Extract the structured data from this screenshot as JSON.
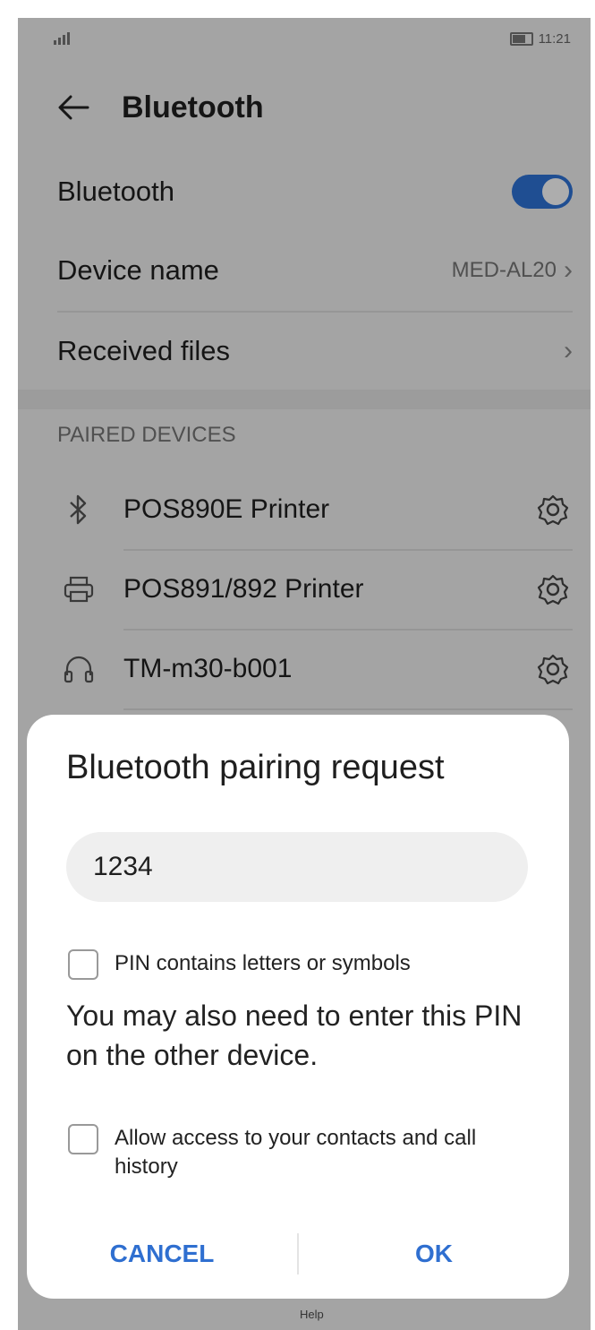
{
  "status_bar": {
    "time": "11:21"
  },
  "header": {
    "title": "Bluetooth",
    "back_icon": "arrow-left-icon"
  },
  "settings": {
    "bluetooth_label": "Bluetooth",
    "bluetooth_enabled": true,
    "device_name_label": "Device name",
    "device_name_value": "MED-AL20",
    "received_files_label": "Received files"
  },
  "paired": {
    "section_label": "PAIRED DEVICES",
    "devices": [
      {
        "name": "POS890E Printer",
        "icon": "bluetooth-icon"
      },
      {
        "name": "POS891/892 Printer",
        "icon": "printer-icon"
      },
      {
        "name": "TM-m30-b001",
        "icon": "headphones-icon"
      }
    ]
  },
  "dialog": {
    "title": "Bluetooth pairing request",
    "pin_value": "1234",
    "pin_letters_label": "PIN contains letters or symbols",
    "message": "You may also need to enter this PIN on the other device.",
    "contacts_label": "Allow access to your contacts and call history",
    "cancel_label": "CANCEL",
    "ok_label": "OK"
  },
  "footer": {
    "help_label": "Help"
  },
  "colors": {
    "accent": "#2f73d8",
    "background": "#f2f2f2"
  }
}
